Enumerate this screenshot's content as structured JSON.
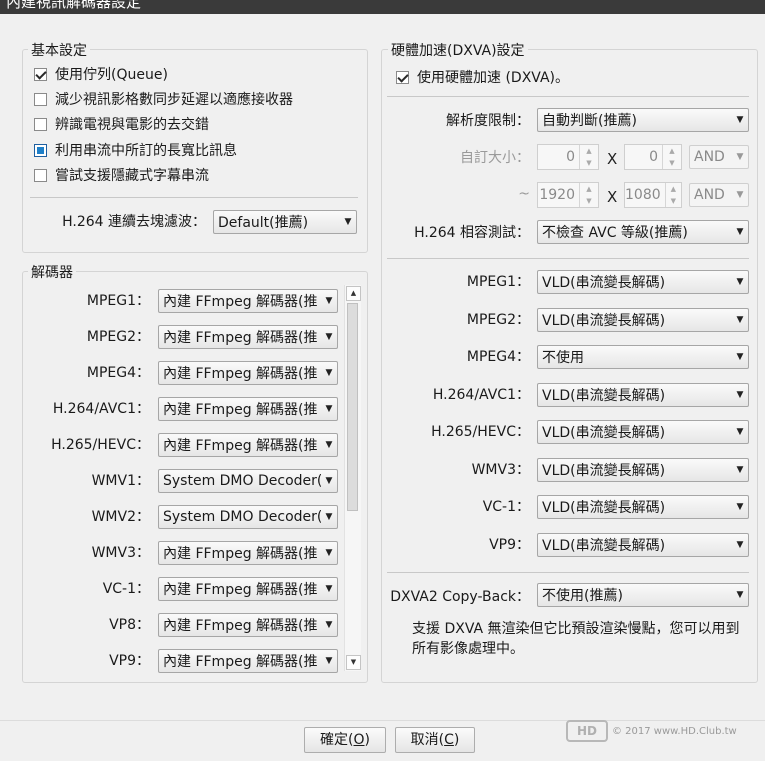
{
  "window": {
    "title": "內建視訊解碼器設定"
  },
  "basic": {
    "title": "基本設定",
    "options": [
      {
        "label": "使用佇列(Queue)",
        "state": "checked"
      },
      {
        "label": "減少視訊影格數同步延遲以適應接收器",
        "state": "unchecked"
      },
      {
        "label": "辨識電視與電影的去交錯",
        "state": "unchecked"
      },
      {
        "label": "利用串流中所訂的長寬比訊息",
        "state": "indeterminate"
      },
      {
        "label": "嘗試支援隱藏式字幕串流",
        "state": "unchecked"
      }
    ],
    "deblock_label": "H.264 連續去塊濾波：",
    "deblock_value": "Default(推薦)"
  },
  "decoders": {
    "title": "解碼器",
    "rows": [
      {
        "label": "MPEG1：",
        "value": "內建 FFmpeg 解碼器(推"
      },
      {
        "label": "MPEG2：",
        "value": "內建 FFmpeg 解碼器(推"
      },
      {
        "label": "MPEG4：",
        "value": "內建 FFmpeg 解碼器(推"
      },
      {
        "label": "H.264/AVC1：",
        "value": "內建 FFmpeg 解碼器(推"
      },
      {
        "label": "H.265/HEVC：",
        "value": "內建 FFmpeg 解碼器(推"
      },
      {
        "label": "WMV1：",
        "value": "System DMO Decoder("
      },
      {
        "label": "WMV2：",
        "value": "System DMO Decoder("
      },
      {
        "label": "WMV3：",
        "value": "內建 FFmpeg 解碼器(推"
      },
      {
        "label": "VC-1：",
        "value": "內建 FFmpeg 解碼器(推"
      },
      {
        "label": "VP8：",
        "value": "內建 FFmpeg 解碼器(推"
      },
      {
        "label": "VP9：",
        "value": "內建 FFmpeg 解碼器(推"
      }
    ]
  },
  "dxva": {
    "title": "硬體加速(DXVA)設定",
    "enable_label": "使用硬體加速 (DXVA)。",
    "res_limit_label": "解析度限制：",
    "res_limit_value": "自動判斷(推薦)",
    "custom_size_label": "自訂大小：",
    "min_w": "0",
    "min_h": "0",
    "tilde": "~",
    "max_w": "1920",
    "max_h": "1080",
    "x_sep": "X",
    "and1": "AND",
    "and2": "AND",
    "h264_compat_label": "H.264 相容測試：",
    "h264_compat_value": "不檢查 AVC 等級(推薦)",
    "rows": [
      {
        "label": "MPEG1：",
        "value": "VLD(串流變長解碼)"
      },
      {
        "label": "MPEG2：",
        "value": "VLD(串流變長解碼)"
      },
      {
        "label": "MPEG4：",
        "value": "不使用"
      },
      {
        "label": "H.264/AVC1：",
        "value": "VLD(串流變長解碼)"
      },
      {
        "label": "H.265/HEVC：",
        "value": "VLD(串流變長解碼)"
      },
      {
        "label": "WMV3：",
        "value": "VLD(串流變長解碼)"
      },
      {
        "label": "VC-1：",
        "value": "VLD(串流變長解碼)"
      },
      {
        "label": "VP9：",
        "value": "VLD(串流變長解碼)"
      }
    ],
    "copyback_label": "DXVA2 Copy-Back：",
    "copyback_value": "不使用(推薦)",
    "note": "支援 DXVA 無渲染但它比預設渲染慢點，您可以用到所有影像處理中。"
  },
  "buttons": {
    "ok_text": "確定(",
    "ok_key": "O",
    "cancel_text": "取消(",
    "cancel_key": "C",
    "close_paren": ")"
  },
  "watermark": {
    "logo": "HD",
    "text": "© 2017 www.HD.Club.tw"
  }
}
